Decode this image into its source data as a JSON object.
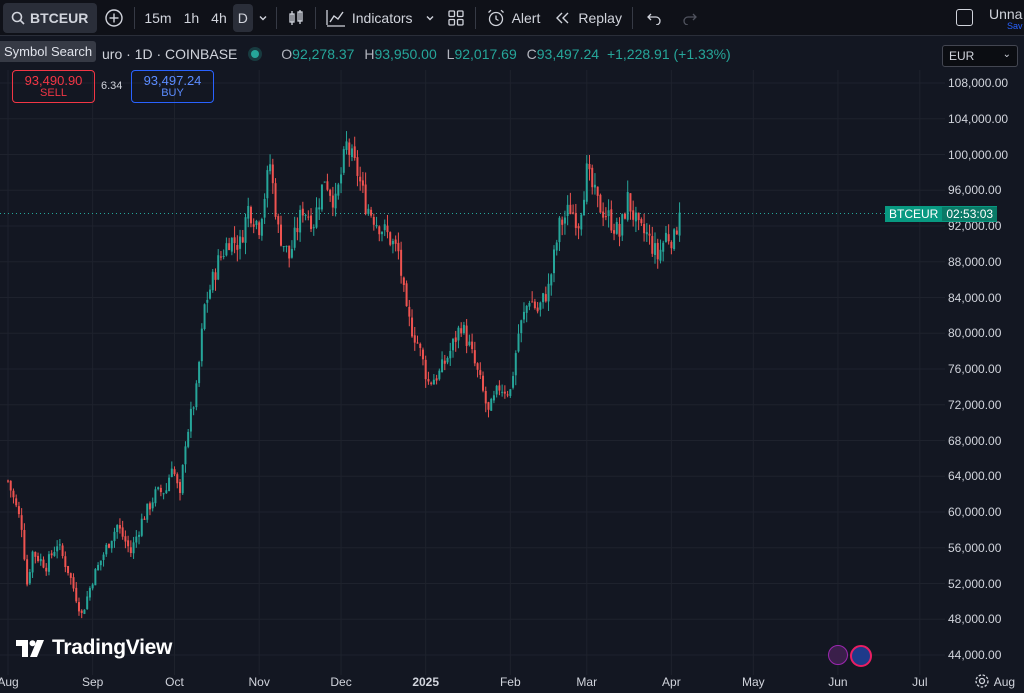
{
  "toolbar": {
    "symbol": "BTCEUR",
    "timeframes": [
      "15m",
      "1h",
      "4h",
      "D"
    ],
    "active_timeframe": "D",
    "indicators_label": "Indicators",
    "alert_label": "Alert",
    "replay_label": "Replay",
    "layout_name": "Unna",
    "saved_label": "Sav"
  },
  "tooltip": {
    "text": "Symbol Search"
  },
  "legend": {
    "title": "uro · 1D · COINBASE",
    "open_key": "O",
    "open": "92,278.37",
    "high_key": "H",
    "high": "93,950.00",
    "low_key": "L",
    "low": "92,017.69",
    "close_key": "C",
    "close": "93,497.24",
    "change": "+1,228.91 (+1.33%)"
  },
  "trade": {
    "sell_price": "93,490.90",
    "sell_label": "SELL",
    "spread": "6.34",
    "buy_price": "93,497.24",
    "buy_label": "BUY"
  },
  "currency": {
    "selected": "EUR"
  },
  "price_tag": {
    "symbol": "BTCEUR",
    "countdown": "02:53:03"
  },
  "brand": {
    "logo_text": "TradingView"
  },
  "colors": {
    "up": "#26a69a",
    "down": "#ef5350",
    "background": "#131722",
    "accent": "#2962ff"
  },
  "chart_data": {
    "type": "candlestick",
    "symbol": "BTCEUR",
    "interval": "1D",
    "exchange": "COINBASE",
    "y_ticks": [
      44000,
      48000,
      52000,
      56000,
      60000,
      64000,
      68000,
      72000,
      76000,
      80000,
      84000,
      88000,
      92000,
      96000,
      100000,
      104000,
      108000
    ],
    "y_tick_labels": [
      "44,000.00",
      "48,000.00",
      "52,000.00",
      "56,000.00",
      "60,000.00",
      "64,000.00",
      "68,000.00",
      "72,000.00",
      "76,000.00",
      "80,000.00",
      "84,000.00",
      "88,000.00",
      "92,000.00",
      "96,000.00",
      "100,000.00",
      "104,000.00",
      "108,000.00"
    ],
    "x_ticks": [
      "Aug",
      "Sep",
      "Oct",
      "Nov",
      "Dec",
      "2025",
      "Feb",
      "Mar",
      "Apr",
      "May",
      "Jun",
      "Jul",
      "Aug"
    ],
    "x_tick_bold": [
      false,
      false,
      false,
      false,
      false,
      true,
      false,
      false,
      false,
      false,
      false,
      false,
      false
    ],
    "ylim": [
      42500,
      110000
    ],
    "current_price": 93497.24,
    "close_path": [
      [
        0,
        63500
      ],
      [
        5,
        58500
      ],
      [
        7,
        52000
      ],
      [
        9,
        55500
      ],
      [
        14,
        54000
      ],
      [
        18,
        56500
      ],
      [
        22,
        53500
      ],
      [
        27,
        48500
      ],
      [
        31,
        52500
      ],
      [
        36,
        56000
      ],
      [
        40,
        58500
      ],
      [
        45,
        55500
      ],
      [
        49,
        59000
      ],
      [
        54,
        62000
      ],
      [
        58,
        62500
      ],
      [
        60,
        65500
      ],
      [
        63,
        61500
      ],
      [
        65,
        68000
      ],
      [
        69,
        73500
      ],
      [
        72,
        83000
      ],
      [
        77,
        88000
      ],
      [
        81,
        90500
      ],
      [
        85,
        90000
      ],
      [
        88,
        94000
      ],
      [
        92,
        92000
      ],
      [
        96,
        99000
      ],
      [
        99,
        91500
      ],
      [
        103,
        88500
      ],
      [
        108,
        94000
      ],
      [
        112,
        92500
      ],
      [
        116,
        97500
      ],
      [
        120,
        94500
      ],
      [
        124,
        101000
      ],
      [
        128,
        98000
      ],
      [
        131,
        94500
      ],
      [
        135,
        92500
      ],
      [
        139,
        91000
      ],
      [
        143,
        89000
      ],
      [
        146,
        82000
      ],
      [
        150,
        79000
      ],
      [
        154,
        74500
      ],
      [
        158,
        75500
      ],
      [
        162,
        78000
      ],
      [
        166,
        81000
      ],
      [
        169,
        78500
      ],
      [
        173,
        74500
      ],
      [
        176,
        71000
      ],
      [
        180,
        74000
      ],
      [
        184,
        73500
      ],
      [
        187,
        80000
      ],
      [
        191,
        84000
      ],
      [
        194,
        82500
      ],
      [
        198,
        85000
      ],
      [
        202,
        92000
      ],
      [
        206,
        94000
      ],
      [
        209,
        92500
      ],
      [
        212,
        98000
      ],
      [
        216,
        94500
      ],
      [
        220,
        93000
      ],
      [
        224,
        91000
      ],
      [
        227,
        95000
      ],
      [
        231,
        91500
      ],
      [
        234,
        91000
      ],
      [
        238,
        88500
      ],
      [
        241,
        91000
      ],
      [
        244,
        90500
      ],
      [
        246,
        93497
      ]
    ],
    "x_tick_days": [
      0,
      31,
      61,
      92,
      122,
      153,
      184,
      212,
      243,
      273,
      304,
      334,
      365
    ]
  }
}
